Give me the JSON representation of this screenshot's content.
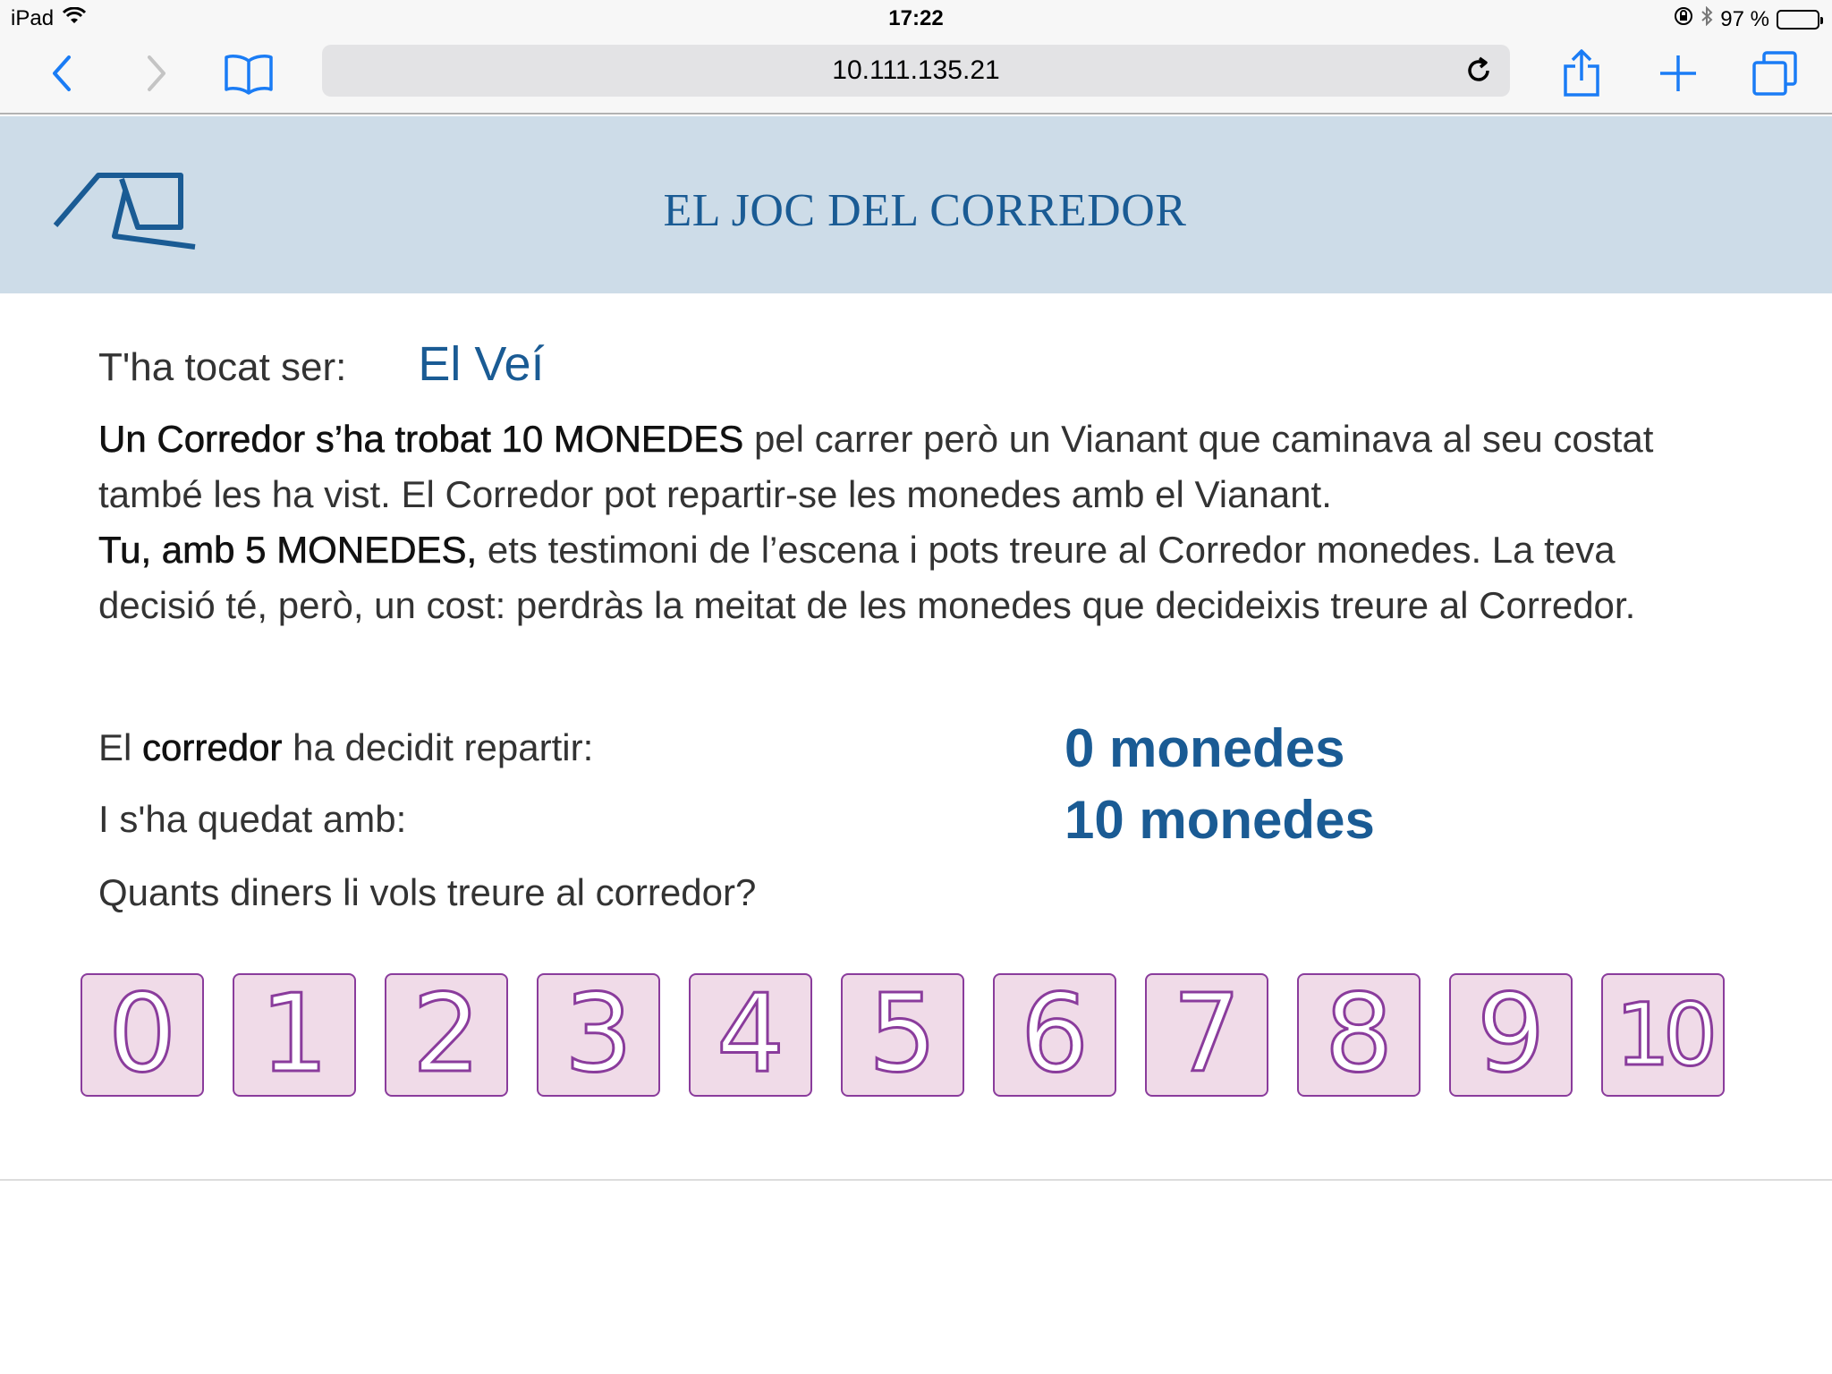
{
  "status_bar": {
    "device": "iPad",
    "time": "17:22",
    "battery": "97 %",
    "battery_level": 0.97
  },
  "browser": {
    "url": "10.111.135.21",
    "icons": [
      "back-icon",
      "forward-icon",
      "bookmarks-icon",
      "reload-icon",
      "share-icon",
      "new-tab-icon",
      "tabs-icon"
    ]
  },
  "header": {
    "title": "EL JOC DEL CORREDOR"
  },
  "role": {
    "label": "T'ha tocat ser:",
    "value": "El Veí"
  },
  "story": {
    "p1_bold": "Un Corredor s’ha trobat 10 MONEDES",
    "p1_rest": " pel carrer però un Vianant que caminava al seu costat també les ha vist. El Corredor pot repartir-se les monedes amb el Vianant.",
    "p2_bold": "Tu, amb 5 MONEDES,",
    "p2_rest": " ets testimoni de l’escena i pots treure al Corredor monedes. La teva decisió té, però, un cost: perdràs la meitat de les monedes que decideixis treure al Corredor."
  },
  "stats": {
    "shared_label_pre": "El ",
    "shared_label_bold": "corredor",
    "shared_label_post": " ha decidit repartir:",
    "shared_value": "0 monedes",
    "kept_label": "I s'ha quedat amb:",
    "kept_value": "10 monedes"
  },
  "question": "Quants diners li vols treure al corredor?",
  "choices": [
    "0",
    "1",
    "2",
    "3",
    "4",
    "5",
    "6",
    "7",
    "8",
    "9",
    "10"
  ],
  "colors": {
    "accent": "#1a5b94",
    "banner": "#cddce8",
    "choice_fill": "#f0dbe8",
    "choice_border": "#8a3c9c"
  }
}
